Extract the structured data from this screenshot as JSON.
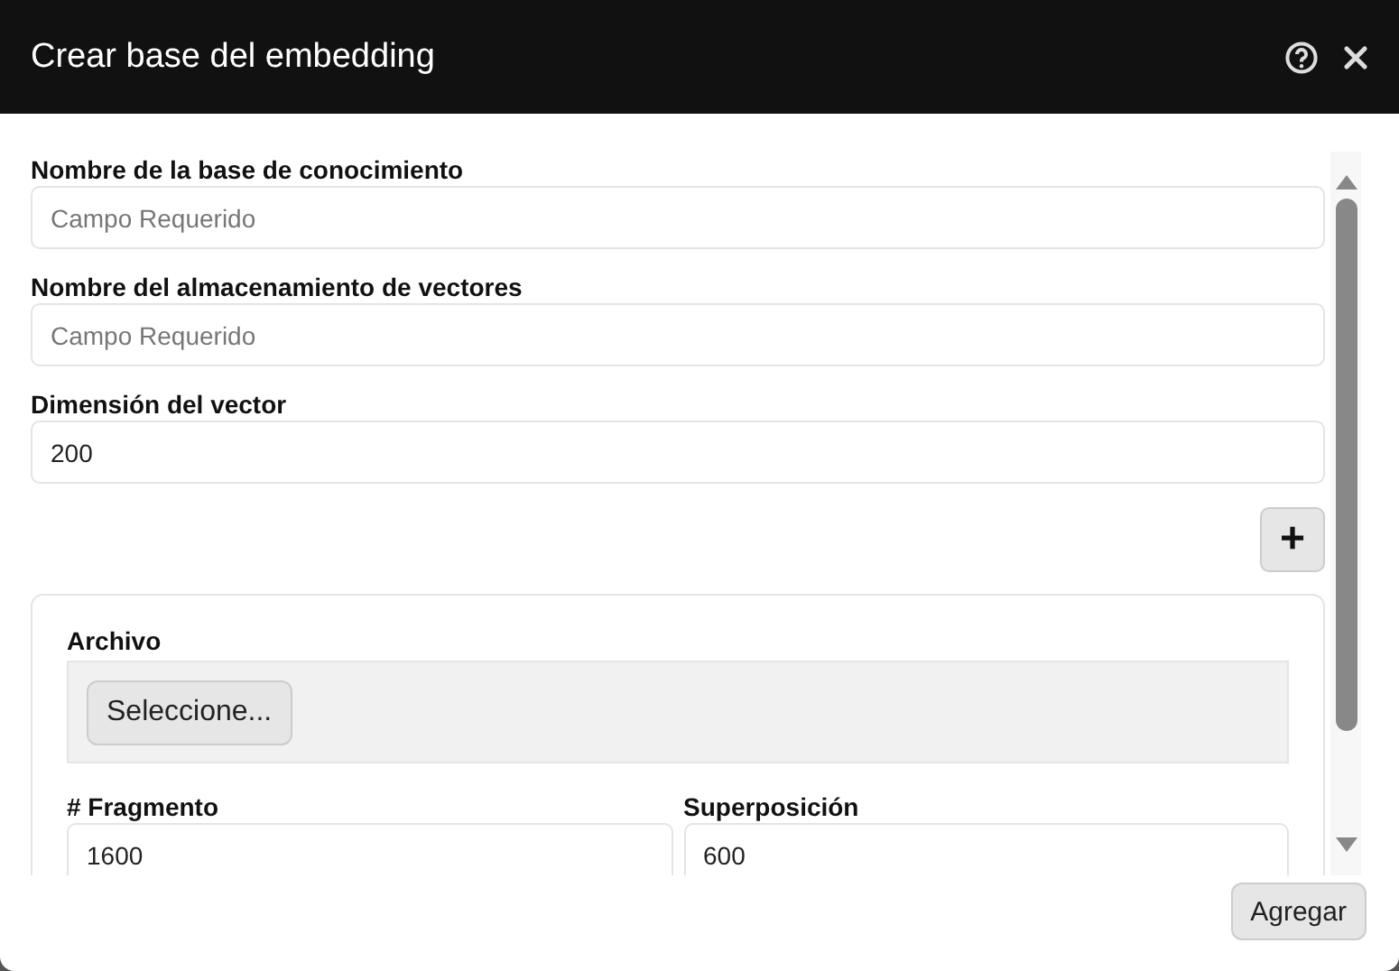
{
  "window": {
    "title": "Crear base del embedding"
  },
  "fields": [
    {
      "label": "Nombre de la base de conocimiento",
      "placeholder": "Campo Requerido"
    },
    {
      "label": "Nombre del almacenamiento de vectores",
      "placeholder": "Campo Requerido"
    },
    {
      "label": "Dimensión del vector",
      "value": "200"
    }
  ],
  "add_button": "+",
  "document": {
    "file_label": "Archivo",
    "file_button": "Seleccione...",
    "fields": [
      {
        "label": "# Fragmento",
        "value": "1600"
      },
      {
        "label": "Superposición",
        "value": "600"
      }
    ]
  },
  "footer": {
    "button": "Agregar"
  }
}
